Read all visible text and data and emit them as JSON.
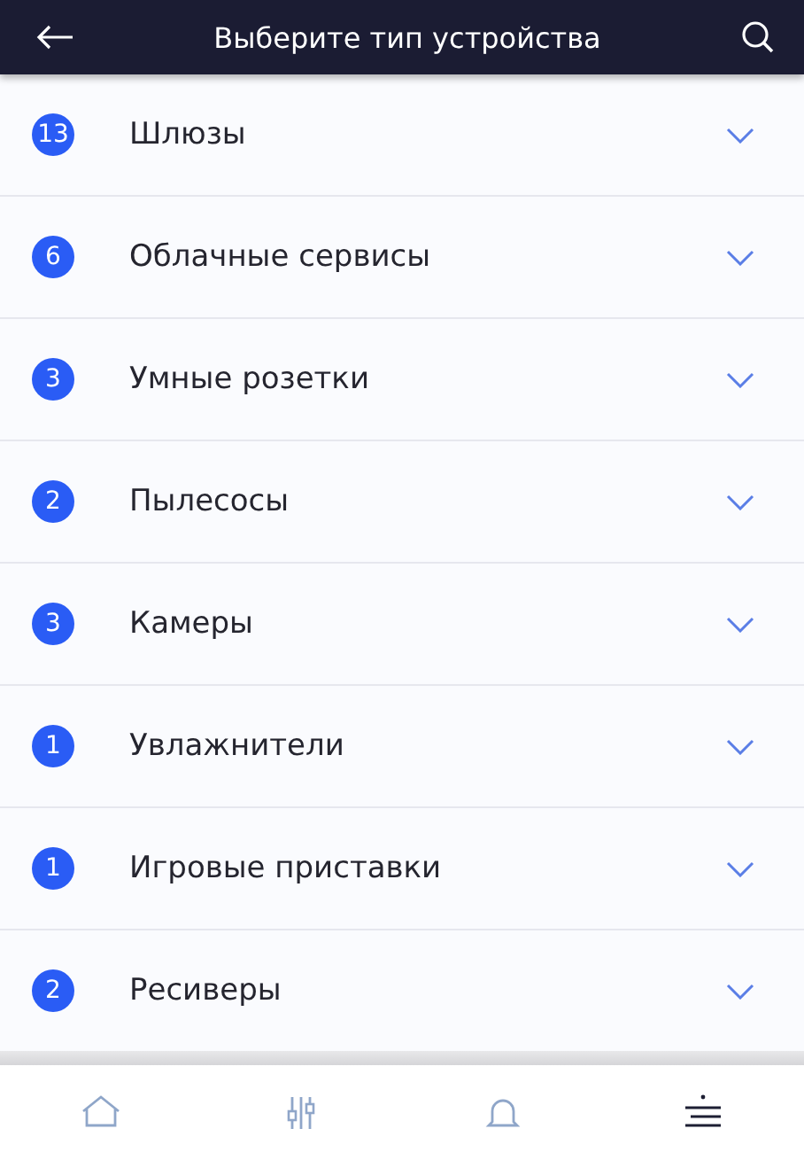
{
  "header": {
    "title": "Выберите тип устройства"
  },
  "categories": [
    {
      "count": "13",
      "label": "Шлюзы",
      "expanded": false
    },
    {
      "count": "6",
      "label": "Облачные сервисы",
      "expanded": false
    },
    {
      "count": "3",
      "label": "Умные розетки",
      "expanded": false
    },
    {
      "count": "2",
      "label": "Пылесосы",
      "expanded": false
    },
    {
      "count": "3",
      "label": "Камеры",
      "expanded": false
    },
    {
      "count": "1",
      "label": "Увлажнители",
      "expanded": false
    },
    {
      "count": "1",
      "label": "Игровые приставки",
      "expanded": false
    },
    {
      "count": "2",
      "label": "Ресиверы",
      "expanded": false
    }
  ],
  "bottom_nav": [
    {
      "kind": "home",
      "selected": false
    },
    {
      "kind": "controls",
      "selected": false
    },
    {
      "kind": "notifications",
      "selected": false
    },
    {
      "kind": "menu",
      "selected": true
    }
  ]
}
